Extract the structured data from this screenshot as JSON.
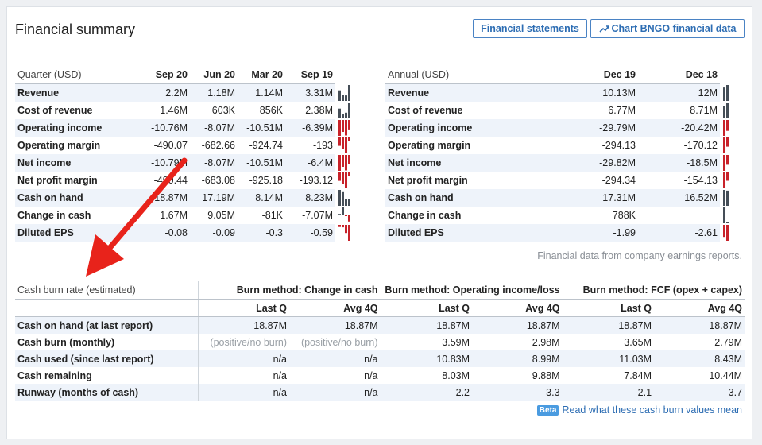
{
  "header": {
    "title": "Financial summary",
    "btn_statements": "Financial statements",
    "btn_chart": "Chart BNGO financial data"
  },
  "quarterly": {
    "label": "Quarter (USD)",
    "periods": [
      "Sep 20",
      "Jun 20",
      "Mar 20",
      "Sep 19"
    ],
    "rows": [
      {
        "label": "Revenue",
        "values": [
          "2.2M",
          "1.18M",
          "1.14M",
          "3.31M"
        ],
        "spark": [
          2.2,
          1.18,
          1.14,
          3.31
        ]
      },
      {
        "label": "Cost of revenue",
        "values": [
          "1.46M",
          "603K",
          "856K",
          "2.38M"
        ],
        "spark": [
          1.46,
          0.603,
          0.856,
          2.38
        ]
      },
      {
        "label": "Operating income",
        "values": [
          "-10.76M",
          "-8.07M",
          "-10.51M",
          "-6.39M"
        ],
        "spark": [
          -10.76,
          -8.07,
          -10.51,
          -6.39
        ]
      },
      {
        "label": "Operating margin",
        "values": [
          "-490.07",
          "-682.66",
          "-924.74",
          "-193"
        ],
        "spark": [
          -490.07,
          -682.66,
          -924.74,
          -193
        ]
      },
      {
        "label": "Net income",
        "values": [
          "-10.79M",
          "-8.07M",
          "-10.51M",
          "-6.4M"
        ],
        "spark": [
          -10.79,
          -8.07,
          -10.51,
          -6.4
        ]
      },
      {
        "label": "Net profit margin",
        "values": [
          "-490.44",
          "-683.08",
          "-925.18",
          "-193.12"
        ],
        "spark": [
          -490.44,
          -683.08,
          -925.18,
          -193.12
        ]
      },
      {
        "label": "Cash on hand",
        "values": [
          "18.87M",
          "17.19M",
          "8.14M",
          "8.23M"
        ],
        "spark": [
          18.87,
          17.19,
          8.14,
          8.23
        ]
      },
      {
        "label": "Change in cash",
        "values": [
          "1.67M",
          "9.05M",
          "-81K",
          "-7.07M"
        ],
        "spark": [
          1.67,
          9.05,
          -0.081,
          -7.07
        ]
      },
      {
        "label": "Diluted EPS",
        "values": [
          "-0.08",
          "-0.09",
          "-0.3",
          "-0.59"
        ],
        "spark": [
          -0.08,
          -0.09,
          -0.3,
          -0.59
        ]
      }
    ]
  },
  "annual": {
    "label": "Annual (USD)",
    "periods": [
      "Dec 19",
      "Dec 18"
    ],
    "rows": [
      {
        "label": "Revenue",
        "values": [
          "10.13M",
          "12M"
        ],
        "spark": [
          10.13,
          12
        ]
      },
      {
        "label": "Cost of revenue",
        "values": [
          "6.77M",
          "8.71M"
        ],
        "spark": [
          6.77,
          8.71
        ]
      },
      {
        "label": "Operating income",
        "values": [
          "-29.79M",
          "-20.42M"
        ],
        "spark": [
          -29.79,
          -20.42
        ]
      },
      {
        "label": "Operating margin",
        "values": [
          "-294.13",
          "-170.12"
        ],
        "spark": [
          -294.13,
          -170.12
        ]
      },
      {
        "label": "Net income",
        "values": [
          "-29.82M",
          "-18.5M"
        ],
        "spark": [
          -29.82,
          -18.5
        ]
      },
      {
        "label": "Net profit margin",
        "values": [
          "-294.34",
          "-154.13"
        ],
        "spark": [
          -294.34,
          -154.13
        ]
      },
      {
        "label": "Cash on hand",
        "values": [
          "17.31M",
          "16.52M"
        ],
        "spark": [
          17.31,
          16.52
        ]
      },
      {
        "label": "Change in cash",
        "values": [
          "788K",
          ""
        ],
        "spark": [
          0.788,
          0
        ]
      },
      {
        "label": "Diluted EPS",
        "values": [
          "-1.99",
          "-2.61"
        ],
        "spark": [
          -1.99,
          -2.61
        ]
      }
    ]
  },
  "earnings_note": "Financial data from company earnings reports.",
  "burn": {
    "label": "Cash burn rate (estimated)",
    "methods": [
      "Burn method: Change in cash",
      "Burn method: Operating income/loss",
      "Burn method: FCF (opex + capex)"
    ],
    "subheaders": [
      "Last Q",
      "Avg 4Q",
      "Last Q",
      "Avg 4Q",
      "Last Q",
      "Avg 4Q"
    ],
    "rows": [
      {
        "label": "Cash on hand (at last report)",
        "values": [
          "18.87M",
          "18.87M",
          "18.87M",
          "18.87M",
          "18.87M",
          "18.87M"
        ]
      },
      {
        "label": "Cash burn (monthly)",
        "values": [
          "(positive/no burn)",
          "(positive/no burn)",
          "3.59M",
          "2.98M",
          "3.65M",
          "2.79M"
        ]
      },
      {
        "label": "Cash used (since last report)",
        "values": [
          "n/a",
          "n/a",
          "10.83M",
          "8.99M",
          "11.03M",
          "8.43M"
        ]
      },
      {
        "label": "Cash remaining",
        "values": [
          "n/a",
          "n/a",
          "8.03M",
          "9.88M",
          "7.84M",
          "10.44M"
        ]
      },
      {
        "label": "Runway (months of cash)",
        "values": [
          "n/a",
          "n/a",
          "2.2",
          "3.3",
          "2.1",
          "3.7"
        ]
      }
    ]
  },
  "footer": {
    "badge": "Beta",
    "link": "Read what these cash burn values mean"
  },
  "colors": {
    "positive_bar": "#454e57",
    "negative_bar": "#c8222a",
    "arrow": "#e8231b",
    "accent": "#2d6db3"
  },
  "icons": {
    "chart_button": "trend-line-icon"
  }
}
